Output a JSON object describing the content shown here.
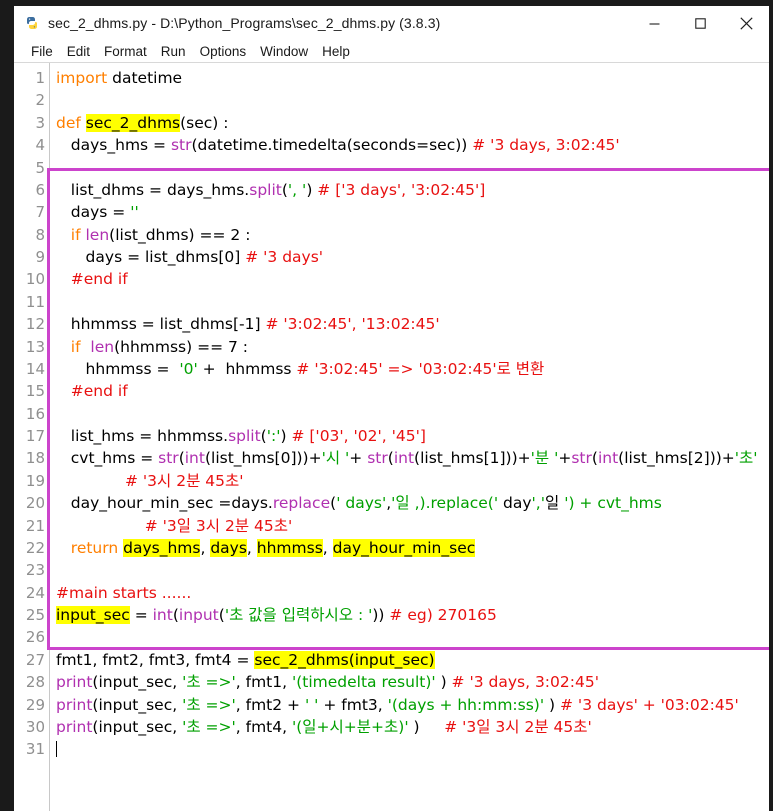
{
  "window": {
    "title": "sec_2_dhms.py - D:\\Python_Programs\\sec_2_dhms.py (3.8.3)",
    "icon_name": "python-idle-icon",
    "controls": {
      "minimize": "—",
      "maximize": "□",
      "close": "✕"
    }
  },
  "menubar": {
    "items": [
      "File",
      "Edit",
      "Format",
      "Run",
      "Options",
      "Window",
      "Help"
    ]
  },
  "editor": {
    "line_numbers": [
      1,
      2,
      3,
      4,
      5,
      6,
      7,
      8,
      9,
      10,
      11,
      12,
      13,
      14,
      15,
      16,
      17,
      18,
      19,
      20,
      21,
      22,
      23,
      24,
      25,
      26,
      27,
      28,
      29,
      30,
      31
    ],
    "lines": [
      "import datetime",
      "",
      "def sec_2_dhms(sec) :",
      "   days_hms = str(datetime.timedelta(seconds=sec)) # '3 days, 3:02:45'",
      "",
      "   list_dhms = days_hms.split(', ') # ['3 days', '3:02:45']",
      "   days = ''",
      "   if len(list_dhms) == 2 :",
      "      days = list_dhms[0] # '3 days'",
      "   #end if",
      "",
      "   hhmmss = list_dhms[-1] # '3:02:45', '13:02:45'",
      "   if  len(hhmmss) == 7 :",
      "      hhmmss =  '0' +  hhmmss # '3:02:45' => '03:02:45'로 변환",
      "   #end if",
      "",
      "   list_hms = hhmmss.split(':') # ['03', '02', '45']",
      "   cvt_hms = str(int(list_hms[0]))+'시 '+ str(int(list_hms[1]))+'분 '+str(int(list_hms[2]))+'초'",
      "              # '3시 2분 45초'",
      "   day_hour_min_sec =days.replace(' days','일 ,).replace(' day','일 ') + cvt_hms",
      "                  # '3일 3시 2분 45초'",
      "   return days_hms, days, hhmmss, day_hour_min_sec",
      "",
      "#main starts ......",
      "input_sec = int(input('초 값을 입력하시오 : ')) # eg) 270165",
      "",
      "fmt1, fmt2, fmt3, fmt4 = sec_2_dhms(input_sec)",
      "print(input_sec, '초 =>', fmt1, '(timedelta result)' ) # '3 days, 3:02:45'",
      "print(input_sec, '초 =>', fmt2 + ' ' + fmt3, '(days + hh:mm:ss)' ) # '3 days' + '03:02:45'",
      "print(input_sec, '초 =>', fmt4, '(일+시+분+초)' )     # '3일 3시 2분 45초'",
      ""
    ]
  },
  "annotation": {
    "purple_box_label": "function-definition-highlight",
    "purple_color": "#cc44cc",
    "highlight_color": "#ffff00"
  },
  "colors": {
    "keyword": "#ff7f00",
    "builtin": "#b030b0",
    "string": "#00a000",
    "comment": "#e81010",
    "line_number": "#8f8f8f",
    "background": "#ffffff",
    "outer_background": "#1a1a1a"
  }
}
